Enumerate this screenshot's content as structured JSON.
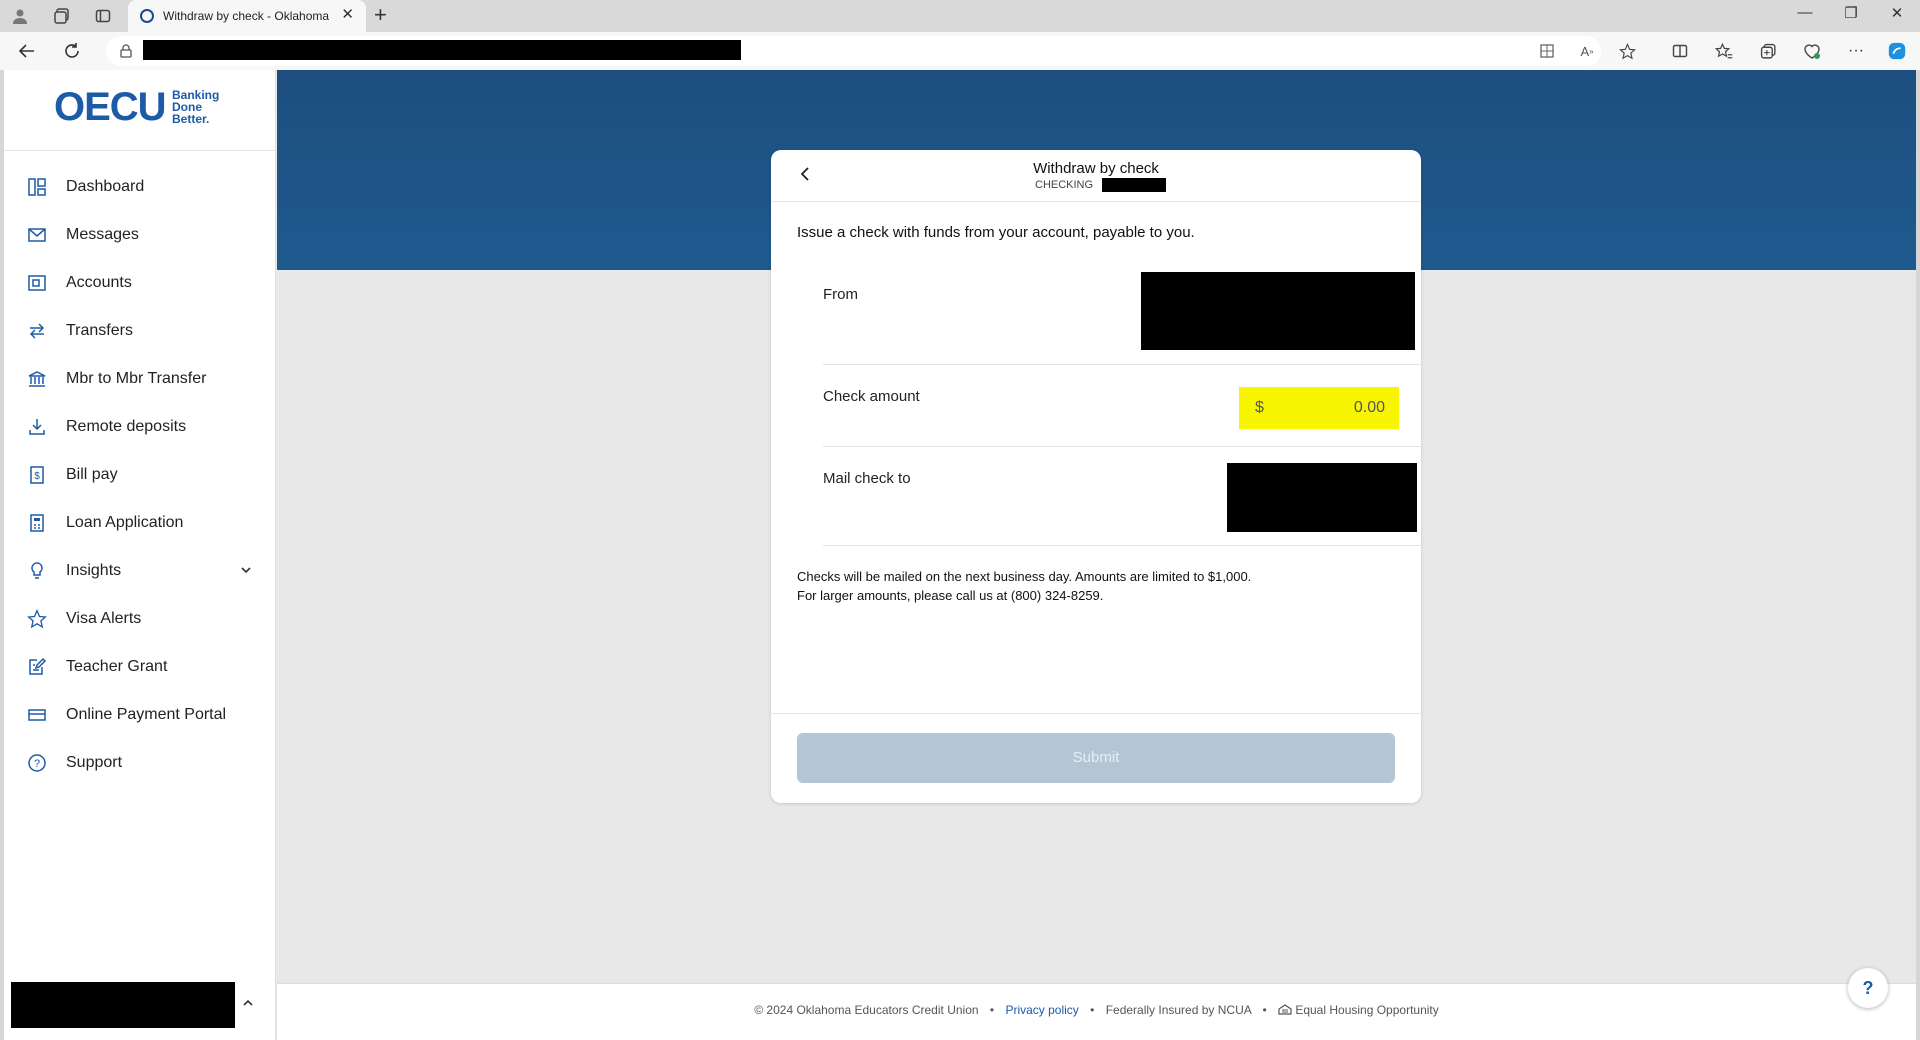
{
  "browser": {
    "tab_title": "Withdraw by check - Oklahoma E",
    "new_tab_icon": "plus-icon"
  },
  "sidebar": {
    "logo_main": "OECU",
    "logo_tag": "Banking Done Better.",
    "items": [
      {
        "label": "Dashboard",
        "icon": "dashboard-icon"
      },
      {
        "label": "Messages",
        "icon": "mail-icon"
      },
      {
        "label": "Accounts",
        "icon": "wallet-icon"
      },
      {
        "label": "Transfers",
        "icon": "transfer-arrows-icon"
      },
      {
        "label": "Mbr to Mbr Transfer",
        "icon": "bank-icon"
      },
      {
        "label": "Remote deposits",
        "icon": "download-icon"
      },
      {
        "label": "Bill pay",
        "icon": "dollar-doc-icon"
      },
      {
        "label": "Loan Application",
        "icon": "calculator-icon"
      },
      {
        "label": "Insights",
        "icon": "lightbulb-icon"
      },
      {
        "label": "Visa Alerts",
        "icon": "star-icon"
      },
      {
        "label": "Teacher Grant",
        "icon": "edit-doc-icon"
      },
      {
        "label": "Online Payment Portal",
        "icon": "card-icon"
      },
      {
        "label": "Support",
        "icon": "help-circle-icon"
      }
    ]
  },
  "card": {
    "title": "Withdraw by check",
    "subtitle": "CHECKING",
    "intro": "Issue a check with funds from your account, payable to you.",
    "from_label": "From",
    "amount_label": "Check amount",
    "currency_symbol": "$",
    "amount_value": "0.00",
    "mail_label": "Mail check to",
    "note_line1": "Checks will be mailed on the next business day. Amounts are limited to $1,000.",
    "note_line2": "For larger amounts, please call us at (800) 324-8259.",
    "submit_label": "Submit"
  },
  "footer": {
    "copyright": "© 2024 Oklahoma Educators Credit Union",
    "privacy": "Privacy policy",
    "insured": "Federally Insured by NCUA",
    "equal_housing": "Equal Housing Opportunity"
  },
  "help_label": "?",
  "colors": {
    "brand_blue": "#1d5aa8",
    "banner": "#1f5a8f",
    "highlight": "#f7f600",
    "submit_disabled": "#b4c6d3"
  }
}
